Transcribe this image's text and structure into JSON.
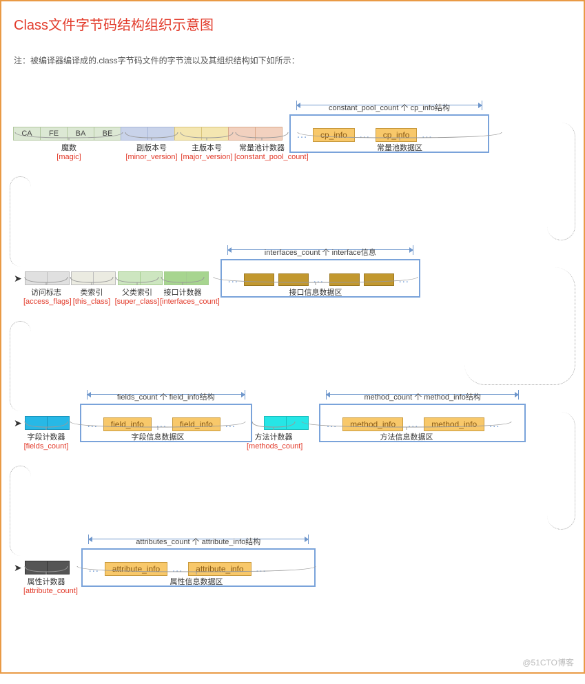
{
  "title": "Class文件字节码结构组织示意图",
  "note": "注：被编译器编译成的.class字节码文件的字节流以及其组织结构如下如所示：",
  "row1": {
    "magic_bytes": [
      "CA",
      "FE",
      "BA",
      "BE"
    ],
    "labels": {
      "magic": {
        "cn": "魔数",
        "en": "[magic]"
      },
      "minor": {
        "cn": "副版本号",
        "en": "[minor_version]"
      },
      "major": {
        "cn": "主版本号",
        "en": "[major_version]"
      },
      "cpcount": {
        "cn": "常量池计数器",
        "en": "[constant_pool_count]"
      }
    },
    "array": {
      "top": "constant_pool_count 个 cp_info结构",
      "token": "cp_info",
      "below": "常量池数据区"
    }
  },
  "row2": {
    "labels": {
      "access": {
        "cn": "访问标志",
        "en": "[access_flags]"
      },
      "this": {
        "cn": "类索引",
        "en": "[this_class]"
      },
      "super": {
        "cn": "父类索引",
        "en": "[super_class]"
      },
      "ifcnt": {
        "cn": "接口计数器",
        "en": "[interfaces_count]"
      }
    },
    "array": {
      "top": "interfaces_count 个 interface信息",
      "below": "接口信息数据区"
    }
  },
  "row3": {
    "fields_label": {
      "cn": "字段计数器",
      "en": "[fields_count]"
    },
    "fields_array": {
      "top": "fields_count 个 field_info结构",
      "token": "field_info",
      "below": "字段信息数据区"
    },
    "methods_label": {
      "cn": "方法计数器",
      "en": "[methods_count]"
    },
    "methods_array": {
      "top": "method_count 个 method_info结构",
      "token": "method_info",
      "below": "方法信息数据区"
    }
  },
  "row4": {
    "attr_label": {
      "cn": "属性计数器",
      "en": "[attribute_count]"
    },
    "attr_array": {
      "top": "attributes_count 个 attribute_info结构",
      "token": "attribute_info",
      "below": "属性信息数据区"
    }
  },
  "watermark": "@51CTO博客"
}
